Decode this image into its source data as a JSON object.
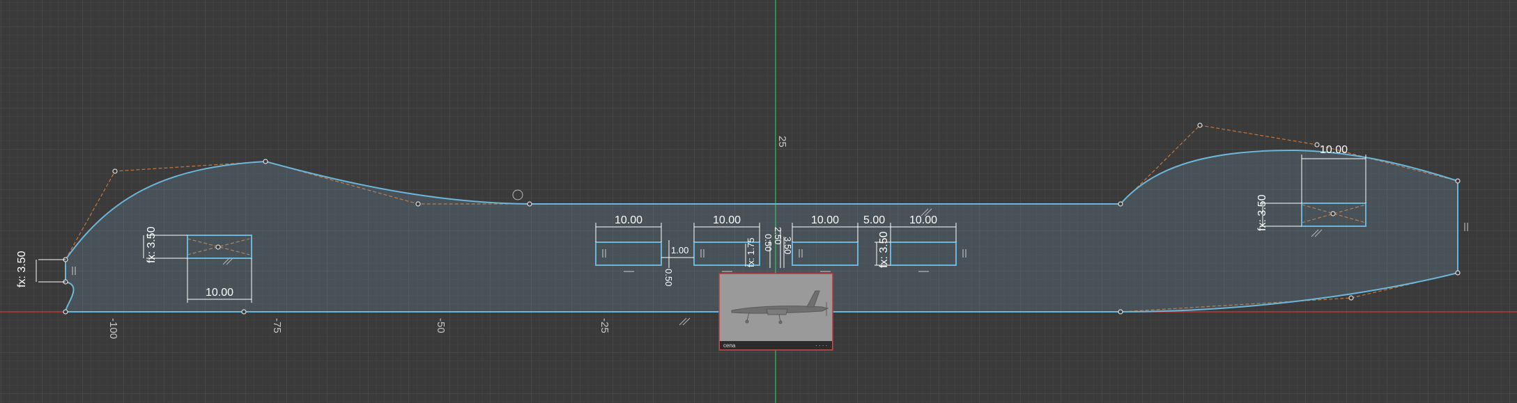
{
  "viewport": {
    "background": "#3a3a3a",
    "grid_minor_color": "#454545",
    "grid_major_color": "#505050",
    "x_axis_color": "#b73a3a",
    "y_axis_color": "#2fa84f"
  },
  "axis_labels": {
    "x": [
      "-100",
      "-75",
      "-50",
      "-25"
    ],
    "y": [
      "25"
    ]
  },
  "sketch": {
    "profile_color": "#6db6d9",
    "construction_color": "#c8763a",
    "fill_color": "rgba(120,165,190,0.22)",
    "rect_color": "#6db6d9"
  },
  "dimensions": {
    "left_fx": "fx: 3.50",
    "left_width": "10.00",
    "left_height_fx": "fx: 3.50",
    "top_row": [
      "10.00",
      "10.00",
      "10.00",
      "5.00",
      "10.00"
    ],
    "gap_small_1": "0.50",
    "gap_small_2": "1.00",
    "mid_fx_1": "fx: 1.75",
    "mid_stack_1": "0.50",
    "mid_stack_2": "2.50",
    "mid_stack_3": "3.50",
    "mid_fx_2": "fx: 3.50",
    "right_width": "10.00",
    "right_fx": "fx: 3.50"
  },
  "canvas_image": {
    "label": "cena",
    "footer_right": "· · · ·"
  }
}
